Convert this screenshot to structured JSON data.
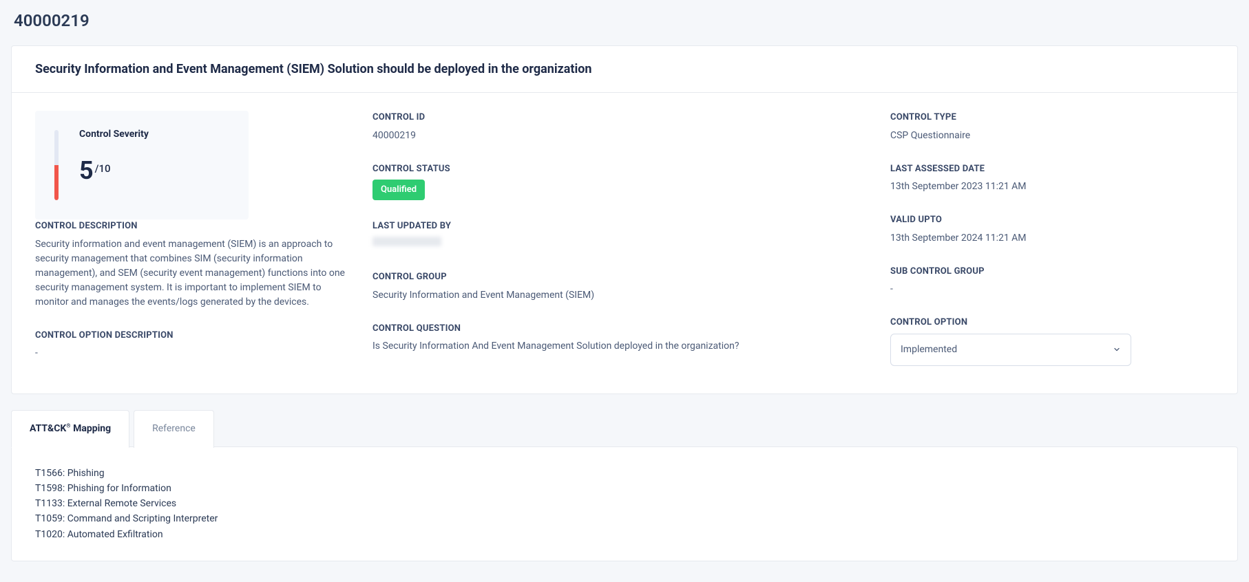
{
  "page_id": "40000219",
  "control_title": "Security Information and Event Management (SIEM) Solution should be deployed in the organization",
  "severity": {
    "label": "Control Severity",
    "value": "5",
    "max": "/10"
  },
  "left": {
    "description_label": "CONTROL DESCRIPTION",
    "description_value": "Security information and event management (SIEM) is an approach to security management that combines SIM (security information management), and SEM (security event management) functions into one security management system. It is important to implement SIEM to monitor and manages the events/logs generated by the devices.",
    "option_desc_label": "CONTROL OPTION DESCRIPTION",
    "option_desc_value": "-"
  },
  "mid": {
    "control_id_label": "CONTROL ID",
    "control_id_value": "40000219",
    "control_status_label": "CONTROL STATUS",
    "control_status_badge": "Qualified",
    "last_updated_by_label": "LAST UPDATED BY",
    "control_group_label": "CONTROL GROUP",
    "control_group_value": "Security Information and Event Management (SIEM)",
    "control_question_label": "CONTROL QUESTION",
    "control_question_value": "Is Security Information And Event Management Solution deployed in the organization?"
  },
  "right": {
    "control_type_label": "CONTROL TYPE",
    "control_type_value": "CSP Questionnaire",
    "last_assessed_label": "LAST ASSESSED DATE",
    "last_assessed_value": "13th September 2023 11:21 AM",
    "valid_upto_label": "VALID UPTO",
    "valid_upto_value": "13th September 2024 11:21 AM",
    "sub_control_group_label": "SUB CONTROL GROUP",
    "sub_control_group_value": "-",
    "control_option_label": "CONTROL OPTION",
    "control_option_value": "Implemented"
  },
  "tabs": {
    "attack_prefix": "ATT&CK",
    "attack_suffix": " Mapping",
    "attack_reg": "®",
    "reference": "Reference"
  },
  "attack_items": [
    "T1566: Phishing",
    "T1598: Phishing for Information",
    "T1133: External Remote Services",
    "T1059: Command and Scripting Interpreter",
    "T1020: Automated Exfiltration"
  ]
}
